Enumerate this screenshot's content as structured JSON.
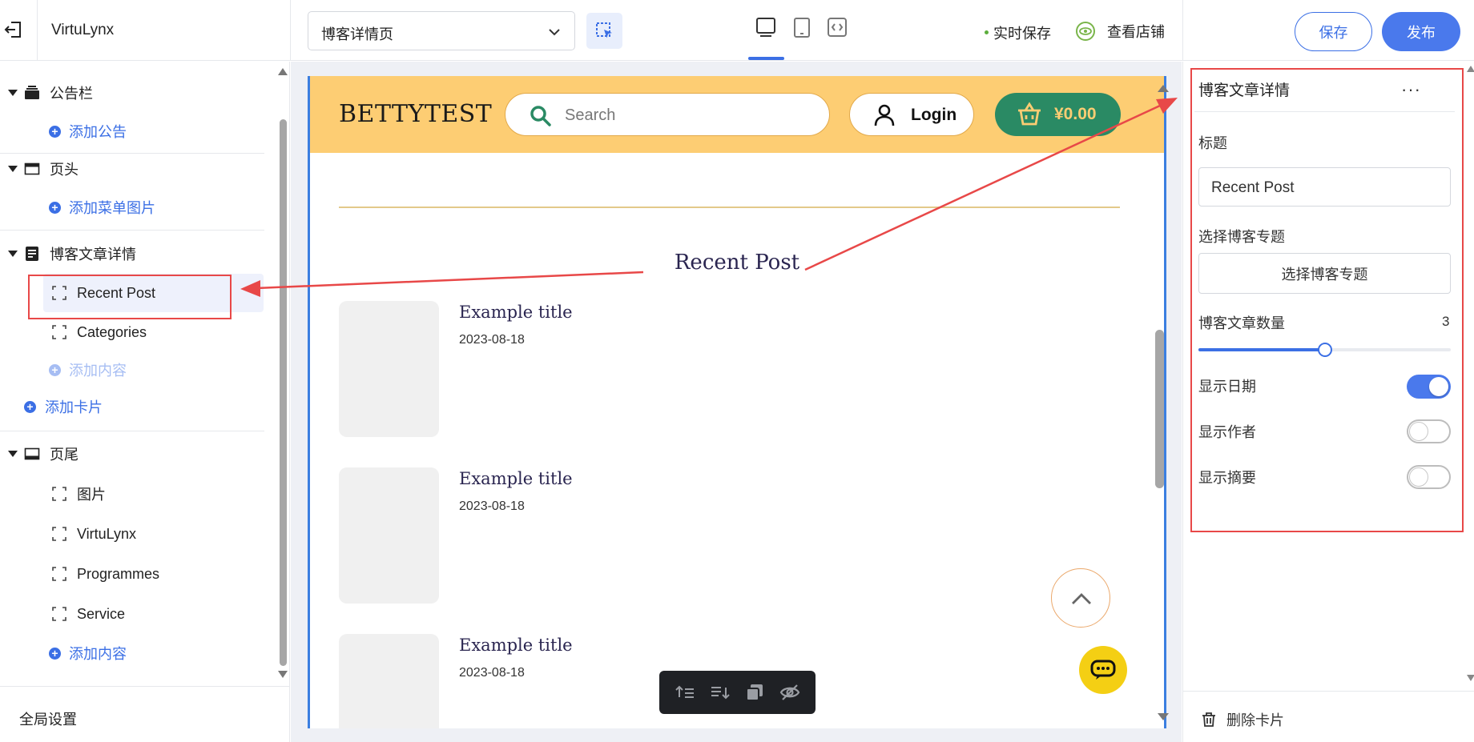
{
  "app": {
    "title": "VirtuLynx"
  },
  "toolbar": {
    "page_select_value": "博客详情页",
    "save_status": "实时保存",
    "view_store_label": "查看店铺",
    "save_label": "保存",
    "publish_label": "发布",
    "device_modes": [
      "desktop-icon",
      "tablet-icon",
      "code-icon"
    ],
    "active_device": "desktop-icon"
  },
  "sidebar": {
    "sections": [
      {
        "label": "公告栏",
        "icon": "announcement-icon",
        "add_label": "添加公告"
      },
      {
        "label": "页头",
        "icon": "header-icon",
        "add_label": "添加菜单图片"
      },
      {
        "label": "博客文章详情",
        "icon": "document-icon",
        "items": [
          "Recent Post",
          "Categories"
        ],
        "selected_item": "Recent Post",
        "add_content_label": "添加内容",
        "add_card_label": "添加卡片"
      },
      {
        "label": "页尾",
        "icon": "footer-icon",
        "items": [
          "图片",
          "VirtuLynx",
          "Programmes",
          "Service"
        ],
        "add_content_label": "添加内容"
      }
    ],
    "global_settings_label": "全局设置"
  },
  "preview": {
    "brand": "BETTYTEST",
    "search_placeholder": "Search",
    "login_label": "Login",
    "cart_amount": "¥0.00",
    "section_heading": "Recent Post",
    "posts": [
      {
        "title": "Example title",
        "date": "2023-08-18"
      },
      {
        "title": "Example title",
        "date": "2023-08-18"
      },
      {
        "title": "Example title",
        "date": "2023-08-18"
      }
    ],
    "floating_toolbar": [
      "move-up-icon",
      "move-down-icon",
      "duplicate-icon",
      "hide-icon"
    ]
  },
  "panel": {
    "title": "博客文章详情",
    "more_label": "···",
    "title_field_label": "标题",
    "title_field_value": "Recent Post",
    "topic_label": "选择博客专题",
    "topic_button": "选择博客专题",
    "count_label": "博客文章数量",
    "count_value": "3",
    "count_fraction": 0.5,
    "show_date_label": "显示日期",
    "show_date": true,
    "show_author_label": "显示作者",
    "show_author": false,
    "show_excerpt_label": "显示摘要",
    "show_excerpt": false,
    "delete_label": "删除卡片"
  },
  "colors": {
    "accent": "#3b6fe5",
    "store_header": "#fdcd73",
    "cart_button": "#2a8a64",
    "annotation": "#e84848"
  }
}
